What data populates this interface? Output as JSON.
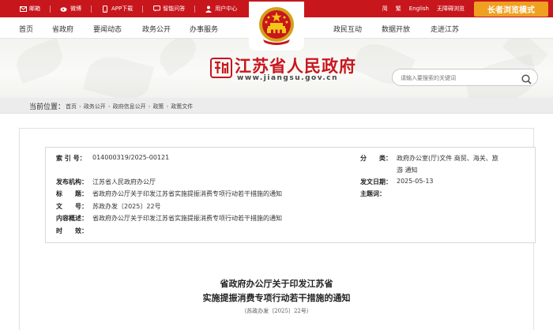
{
  "topbar": {
    "links": [
      "邮箱",
      "微博",
      "APP下载",
      "智能问答",
      "用户中心"
    ],
    "right_links": [
      "简",
      "繁",
      "English",
      "无障碍浏览"
    ],
    "elder_mode": "长者浏览模式"
  },
  "nav": {
    "left": [
      "首页",
      "省政府",
      "要闻动态",
      "政务公开",
      "办事服务"
    ],
    "right": [
      "政民互动",
      "数据开放",
      "走进江苏"
    ]
  },
  "header": {
    "site_title": "江苏省人民政府",
    "site_url": "www.jiangsu.gov.cn"
  },
  "search": {
    "placeholder": "请输入要搜索的关键词"
  },
  "breadcrumb": {
    "label": "当前位置：",
    "items": [
      "首页",
      "政务公开",
      "政府信息公开",
      "政策",
      "政策文件"
    ]
  },
  "meta": {
    "index_key": "索 引 号：",
    "index_val": "014000319/2025-00121",
    "org_key": "发布机构：",
    "org_val": "江苏省人民政府办公厅",
    "title_key": "标　　题：",
    "title_val": "省政府办公厅关于印发江苏省实施提振消费专项行动若干措施的通知",
    "docno_key": "文　　号：",
    "docno_val": "苏政办发〔2025〕22号",
    "summary_key": "内容概述：",
    "summary_val": "省政府办公厅关于印发江苏省实施提振消费专项行动若干措施的通知",
    "valid_key": "时　　效：",
    "valid_val": "",
    "category_key": "分　　类：",
    "category_val_1": "政府办公室(厅)文件 商贸、海关、旅",
    "category_val_2": "游 通知",
    "date_key": "发文日期：",
    "date_val": "2025-05-13",
    "subject_key": "主题词：",
    "subject_val": ""
  },
  "document": {
    "title_line1": "省政府办公厅关于印发江苏省",
    "title_line2": "实施提振消费专项行动若干措施的通知",
    "doc_number": "（苏政办发〔2025〕22号）"
  },
  "colors": {
    "brand_red": "#c8161d",
    "elder_orange": "#f0a020"
  }
}
